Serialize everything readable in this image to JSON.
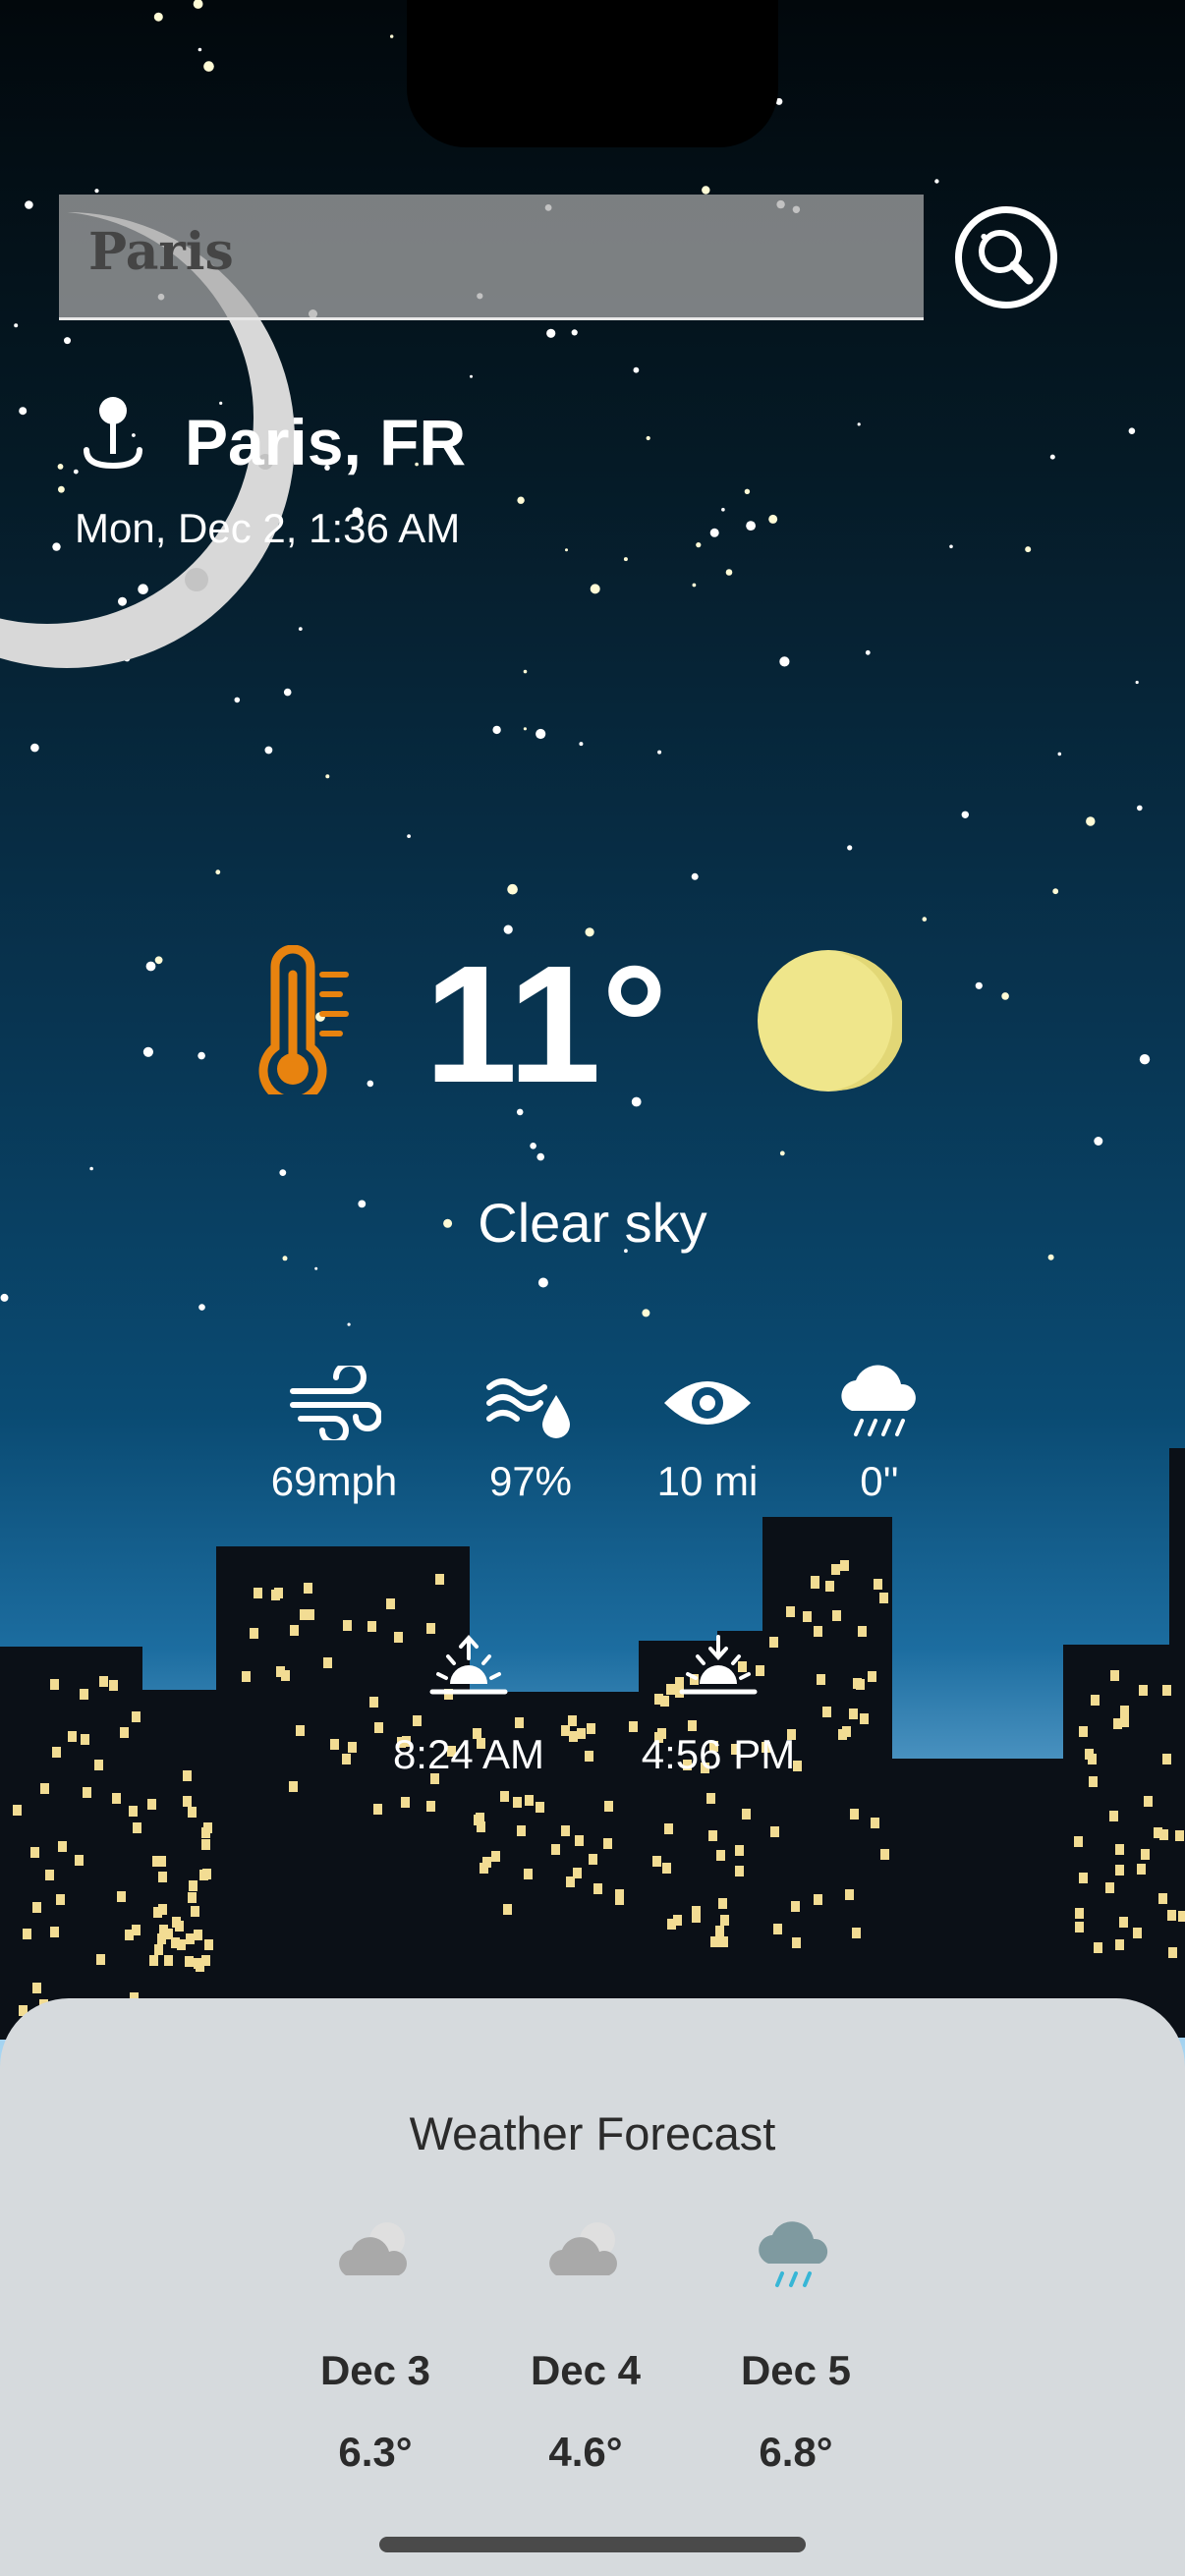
{
  "search": {
    "value": "Paris",
    "button": "search-icon"
  },
  "location": {
    "city": "Paris, FR",
    "datetime": "Mon, Dec 2, 1:36 AM",
    "icon": "location-pin-icon"
  },
  "current": {
    "temperature": "11°",
    "condition": "Clear sky",
    "icon": "moon-icon",
    "thermometer_color": "#e8830f",
    "moon_color": "#efe68b"
  },
  "stats": [
    {
      "icon": "wind-icon",
      "label": "69mph"
    },
    {
      "icon": "humidity-icon",
      "label": "97%"
    },
    {
      "icon": "visibility-eye-icon",
      "label": "10 mi"
    },
    {
      "icon": "rain-cloud-icon",
      "label": "0''"
    }
  ],
  "sun": {
    "sunrise": {
      "icon": "sunrise-icon",
      "time": "8:24 AM"
    },
    "sunset": {
      "icon": "sunset-icon",
      "time": "4:56 PM"
    }
  },
  "forecast": {
    "title": "Weather Forecast",
    "days": [
      {
        "date": "Dec 3",
        "temp": "6.3°",
        "icon": "cloud-icon"
      },
      {
        "date": "Dec 4",
        "temp": "4.6°",
        "icon": "cloud-icon"
      },
      {
        "date": "Dec 5",
        "temp": "6.8°",
        "icon": "rain-cloud-icon"
      }
    ]
  }
}
